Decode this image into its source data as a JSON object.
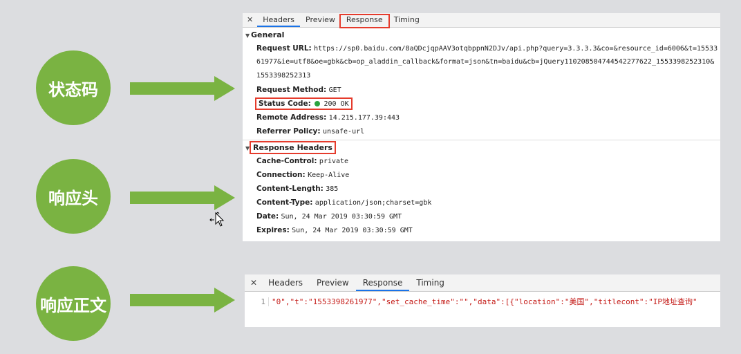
{
  "labels": {
    "status_code": "状态码",
    "response_headers": "响应头",
    "response_body": "响应正文"
  },
  "colors": {
    "accent_green": "#7ab342",
    "highlight_red": "#e53b2c",
    "status_dot": "#2aa33f"
  },
  "panel1": {
    "tabs": [
      "Headers",
      "Preview",
      "Response",
      "Timing"
    ],
    "active_tab": "Headers",
    "general_title": "General",
    "general": {
      "request_url_key": "Request URL:",
      "request_url_l1": "https://sp0.baidu.com/8aQDcjqpAAV3otqbppnN2DJv/api.php?query=3.3.3.3&co=&resource_id=6006&t=15533",
      "request_url_l2": "61977&ie=utf8&oe=gbk&cb=op_aladdin_callback&format=json&tn=baidu&cb=jQuery110208504744542277622_1553398252310&",
      "request_url_l3": "1553398252313",
      "method_key": "Request Method:",
      "method_val": "GET",
      "status_key": "Status Code:",
      "status_val": "200 OK",
      "remote_key": "Remote Address:",
      "remote_val": "14.215.177.39:443",
      "referrer_key": "Referrer Policy:",
      "referrer_val": "unsafe-url"
    },
    "response_headers_title": "Response Headers",
    "response_headers": [
      {
        "k": "Cache-Control:",
        "v": "private"
      },
      {
        "k": "Connection:",
        "v": "Keep-Alive"
      },
      {
        "k": "Content-Length:",
        "v": "385"
      },
      {
        "k": "Content-Type:",
        "v": "application/json;charset=gbk"
      },
      {
        "k": "Date:",
        "v": "Sun, 24 Mar 2019 03:30:59 GMT"
      },
      {
        "k": "Expires:",
        "v": "Sun, 24 Mar 2019 03:30:59 GMT"
      }
    ]
  },
  "panel2": {
    "tabs": [
      "Headers",
      "Preview",
      "Response",
      "Timing"
    ],
    "active_tab": "Response",
    "line_number": "1",
    "code_line": "\"0\",\"t\":\"1553398261977\",\"set_cache_time\":\"\",\"data\":[{\"location\":\"美国\",\"titlecont\":\"IP地址查询\""
  }
}
